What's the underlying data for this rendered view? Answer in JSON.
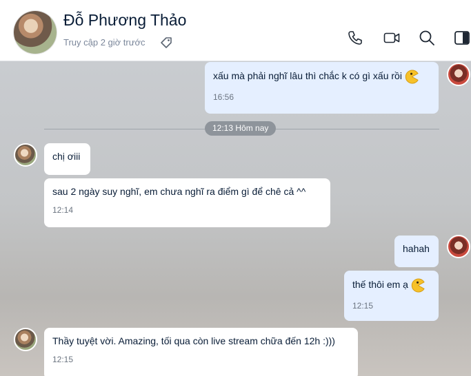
{
  "header": {
    "name": "Đỗ Phương Thảo",
    "status": "Truy cập 2 giờ trước"
  },
  "icons": {
    "tag": "tag-icon",
    "call": "phone-icon",
    "video": "video-camera-icon",
    "search": "search-icon",
    "panel": "panel-toggle-icon"
  },
  "chat": {
    "divider": "12:13 Hôm nay",
    "messages": [
      {
        "sender": "me",
        "text": "xấu mà phải nghĩ lâu thì chắc k có gì xấu rồi",
        "time": "16:56"
      },
      {
        "sender": "them",
        "text": "chị ơiii"
      },
      {
        "sender": "them",
        "text": "sau 2 ngày suy nghĩ, em chưa nghĩ ra điểm gì để chê cả ^^",
        "time": "12:14"
      },
      {
        "sender": "me",
        "text": "hahah"
      },
      {
        "sender": "me",
        "text": "thế thôi em ạ",
        "time": "12:15"
      },
      {
        "sender": "them",
        "text": "Thầy tuyệt vời. Amazing, tối qua còn live stream chữa đến 12h :)))",
        "time": "12:15"
      }
    ]
  },
  "colors": {
    "my_bubble": "#e5efff",
    "their_bubble": "#ffffff",
    "text": "#081c36"
  }
}
